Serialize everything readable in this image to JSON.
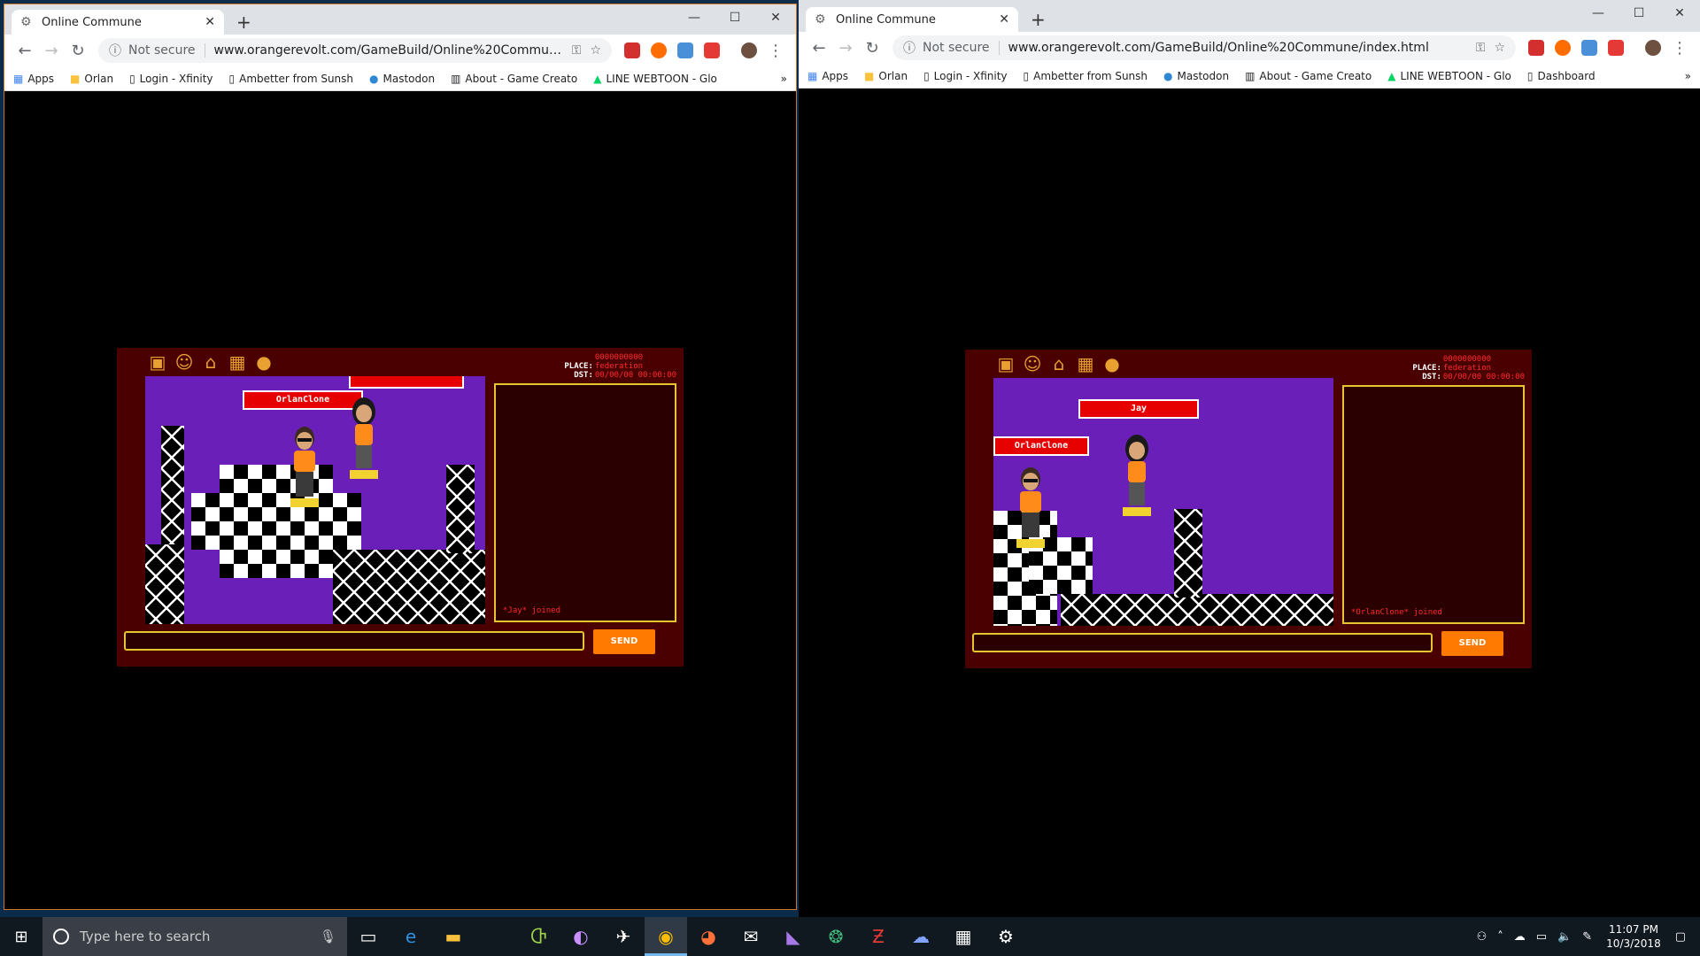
{
  "left_window": {
    "tab_title": "Online Commune",
    "window_controls": [
      "—",
      "☐",
      "✕"
    ],
    "omnibox": {
      "security": "Not secure",
      "url": "www.orangerevolt.com/GameBuild/Online%20Commune/..."
    },
    "bookmarks": [
      "Apps",
      "Orlan",
      "Login - Xfinity",
      "Ambetter from Sunsh",
      "Mastodon",
      "About - Game Creato",
      "LINE WEBTOON - Glo"
    ],
    "game": {
      "hud": {
        "place_label": "PLACE:",
        "place_value": "federation",
        "dst_label": "DST:",
        "dst_value": "00/00/00 00:00:00",
        "top_value": "0000000000"
      },
      "nametags": [
        "OrlanClone",
        ""
      ],
      "chat_log": "*Jay* joined",
      "send_label": "SEND"
    }
  },
  "right_window": {
    "tab_title": "Online Commune",
    "window_controls": [
      "—",
      "☐",
      "✕"
    ],
    "omnibox": {
      "security": "Not secure",
      "url": "www.orangerevolt.com/GameBuild/Online%20Commune/index.html"
    },
    "bookmarks": [
      "Apps",
      "Orlan",
      "Login - Xfinity",
      "Ambetter from Sunsh",
      "Mastodon",
      "About - Game Creato",
      "LINE WEBTOON - Glo",
      "Dashboard"
    ],
    "game": {
      "hud": {
        "place_label": "PLACE:",
        "place_value": "federation",
        "dst_label": "DST:",
        "dst_value": "00/00/00 00:00:00",
        "top_value": "0000000000"
      },
      "nametags": [
        "Jay",
        "OrlanClone"
      ],
      "chat_log": "*OrlanClone* joined",
      "send_label": "SEND"
    }
  },
  "taskbar": {
    "search_placeholder": "Type here to search",
    "time": "11:07 PM",
    "date": "10/3/2018"
  },
  "colors": {
    "game_frame": "#4a0000",
    "room_floor": "#6a1fb8",
    "accent_red": "#e60000",
    "send_orange": "#ff7a00",
    "chat_border": "#e6c530"
  }
}
